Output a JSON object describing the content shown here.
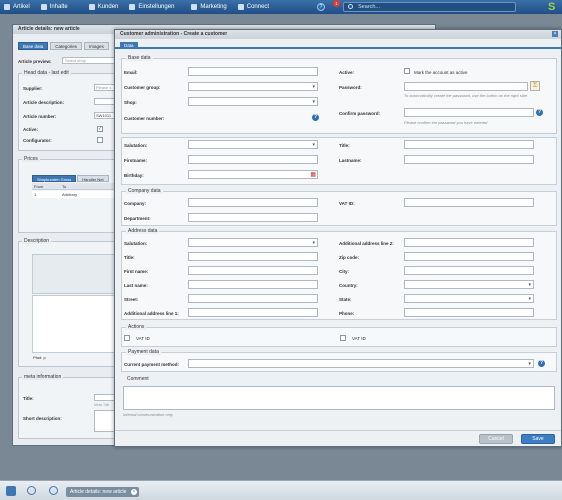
{
  "topbar": {
    "nav": [
      "Artikel",
      "Inhalte",
      "Kunden",
      "Einstellungen",
      "Marketing",
      "Connect"
    ],
    "badge": "1",
    "help": "?",
    "search_placeholder": "Search...",
    "logo": "S"
  },
  "article_window": {
    "title": "Article details: new article",
    "tabs": [
      "Base data",
      "Categories",
      "Images"
    ],
    "preview_label": "Article preview:",
    "preview_placeholder": "Select shop",
    "head_legend": "Head data - last edit",
    "fields": [
      "Supplier:",
      "Article description:",
      "Article number:",
      "Active:",
      "Configurator:"
    ],
    "supplier_placeholder": "Please s",
    "article_number": "SW1011",
    "prices_legend": "Prices",
    "price_tabs": [
      "Shopkunden Gross",
      "Händler Net"
    ],
    "price_cols": [
      "From",
      "To"
    ],
    "price_row": [
      "1",
      "Arbitrary"
    ],
    "description_legend": "Description",
    "editor_status": "Pfad: p",
    "meta_legend": "meta information",
    "meta_fields": [
      "Title:",
      "Short description:"
    ],
    "meta_hint": "Meta-Title"
  },
  "modal": {
    "title": "Customer administration - Create a customer",
    "tab": "Data",
    "base": {
      "legend": "Base data",
      "email": "Email:",
      "customer_group": "Customer group:",
      "shop": "Shop:",
      "customer_number": "Customer number:",
      "active": "Active:",
      "active_note": "Mark the account as active",
      "password": "Password:",
      "password_hint": "To automatically create the password, use the button on the right side.",
      "confirm": "Confirm password:",
      "confirm_hint": "Please confirm the password you have entered"
    },
    "personal": {
      "salutation": "Salutation:",
      "firstname": "Firstname:",
      "birthday": "Birthday:",
      "title": "Title:",
      "lastname": "Lastname:"
    },
    "company": {
      "legend": "Company data",
      "company": "Company:",
      "department": "Department:",
      "vat": "VAT ID:"
    },
    "address": {
      "legend": "Address data",
      "salutation": "Salutation:",
      "title": "Title:",
      "first": "First name:",
      "last": "Last name:",
      "street": "Street:",
      "add1": "Additional address line 1:",
      "add2": "Additional address line 2:",
      "zip": "Zip code:",
      "city": "City:",
      "country": "Country:",
      "state": "State:",
      "phone": "Phone:"
    },
    "actions": {
      "legend": "Actions",
      "vat1": "VAT ID",
      "vat2": "VAT ID"
    },
    "payment": {
      "legend": "Payment data",
      "method": "Current payment method:"
    },
    "comment": {
      "legend": "Comment",
      "hint": "Internal communication only"
    },
    "buttons": {
      "cancel": "Cancel",
      "save": "Save"
    }
  },
  "taskbar": {
    "item": "Article details: new article"
  }
}
